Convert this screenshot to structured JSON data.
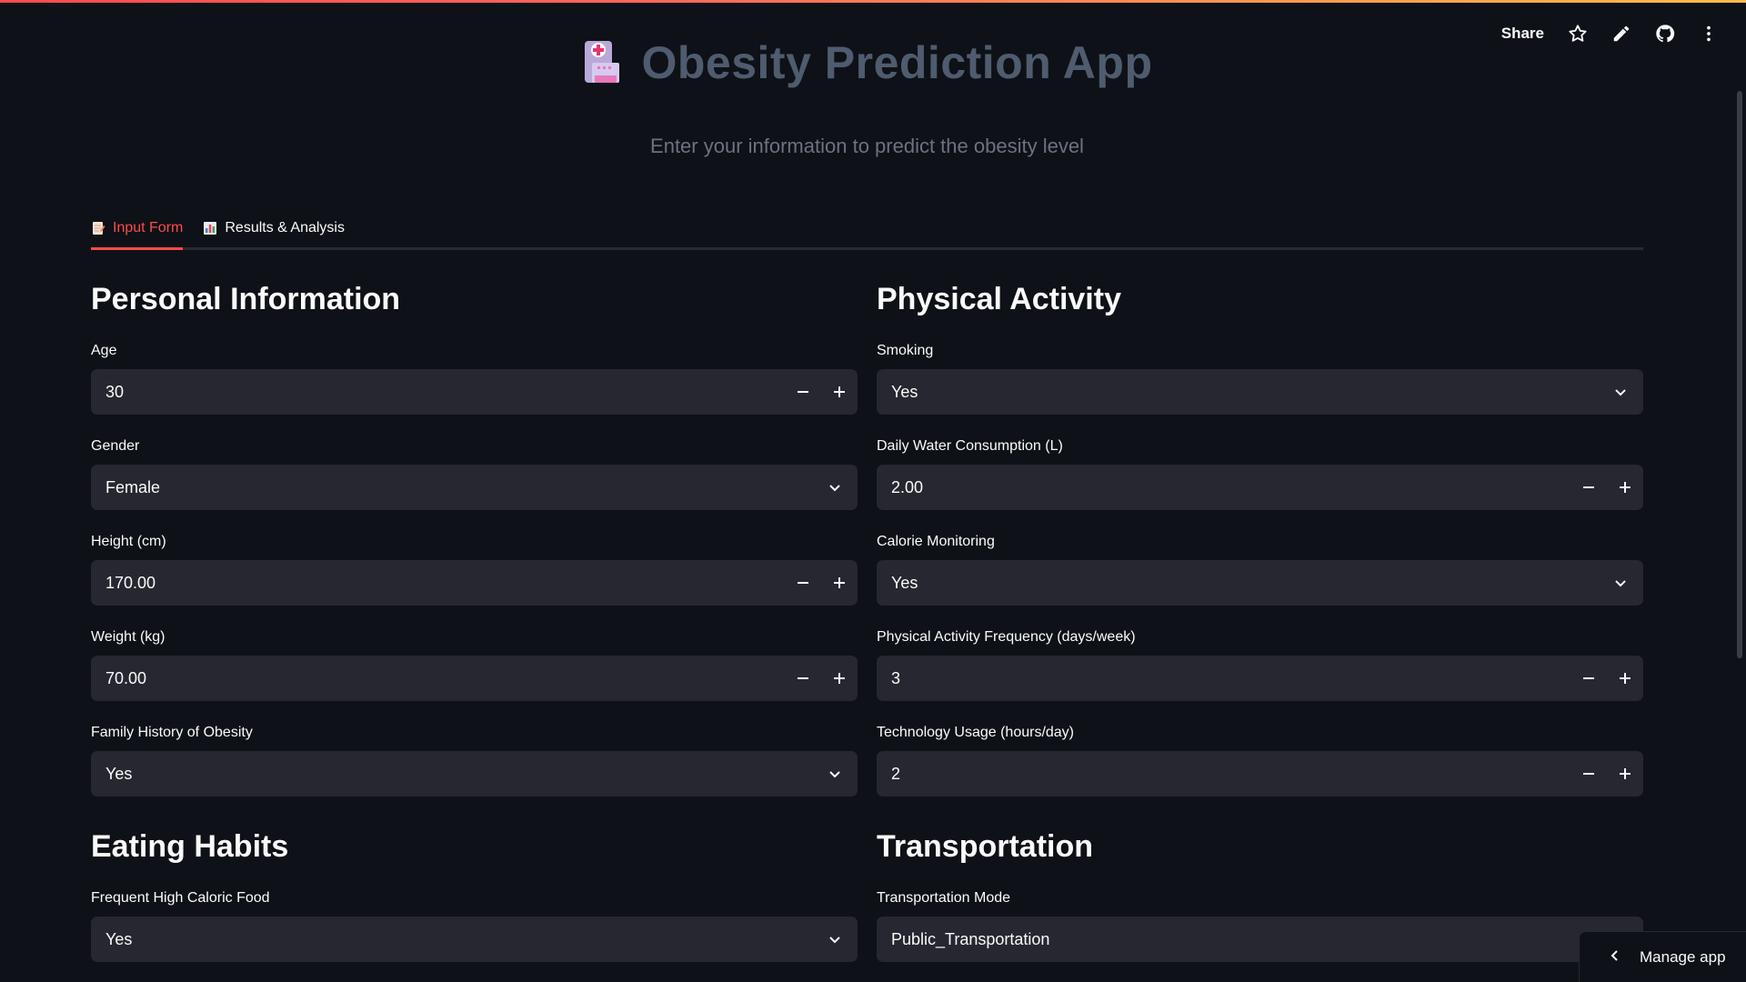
{
  "header": {
    "share_label": "Share",
    "icons": [
      "star-icon",
      "pencil-icon",
      "github-icon",
      "more-vertical-icon"
    ]
  },
  "app": {
    "title": "Obesity Prediction App",
    "subtitle": "Enter your information to predict the obesity level",
    "accent_color": "#ff4b4b"
  },
  "tabs": [
    {
      "label": "Input Form",
      "icon": "memo-icon",
      "active": true
    },
    {
      "label": "Results & Analysis",
      "icon": "bar-chart-icon",
      "active": false
    }
  ],
  "personal": {
    "title": "Personal Information",
    "age": {
      "label": "Age",
      "value": "30"
    },
    "gender": {
      "label": "Gender",
      "value": "Female"
    },
    "height": {
      "label": "Height (cm)",
      "value": "170.00"
    },
    "weight": {
      "label": "Weight (kg)",
      "value": "70.00"
    },
    "family_history": {
      "label": "Family History of Obesity",
      "value": "Yes"
    }
  },
  "physical": {
    "title": "Physical Activity",
    "smoking": {
      "label": "Smoking",
      "value": "Yes"
    },
    "water": {
      "label": "Daily Water Consumption (L)",
      "value": "2.00"
    },
    "calorie_monitoring": {
      "label": "Calorie Monitoring",
      "value": "Yes"
    },
    "activity_freq": {
      "label": "Physical Activity Frequency (days/week)",
      "value": "3"
    },
    "tech_usage": {
      "label": "Technology Usage (hours/day)",
      "value": "2"
    }
  },
  "eating": {
    "title": "Eating Habits",
    "high_caloric": {
      "label": "Frequent High Caloric Food",
      "value": "Yes"
    }
  },
  "transport": {
    "title": "Transportation",
    "mode": {
      "label": "Transportation Mode",
      "value": "Public_Transportation"
    }
  },
  "footer": {
    "manage_app_label": "Manage app"
  }
}
